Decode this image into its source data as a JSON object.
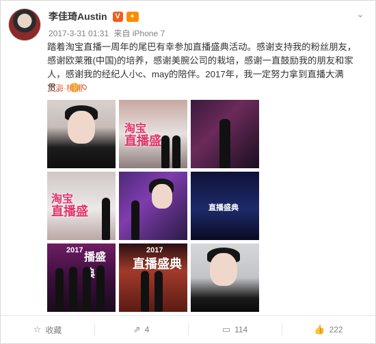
{
  "post": {
    "username": "李佳琦Austin",
    "verified_badge": "V",
    "member_badge": "会员",
    "timestamp": "2017-3-31 01:31",
    "source": "来自 iPhone 7",
    "text": "踏着淘宝直播一周年的尾巴有幸参加直播盛典活动。感谢支持我的粉丝朋友，感谢欧莱雅(中国)的培养，感谢美腕公司的栽培，感谢一直鼓励我的朋友和家人，感谢我的经纪人小c、may的陪伴。2017年，我一定努力拿到直播大满贯。",
    "location": "上海·桃浦"
  },
  "photos": {
    "p2_label_1": "淘宝",
    "p2_label_2": "直播盛",
    "p4_label_1": "淘宝",
    "p4_label_2": "直播盛",
    "p6_label_1": "直播盛典",
    "p7_label": "2017",
    "p7_label_2": "播盛典",
    "p8_label": "2017",
    "p8_label_2": "直播盛典"
  },
  "actions": {
    "favorite_label": "收藏",
    "repost_count": "4",
    "comment_count": "114",
    "like_count": "222"
  },
  "colors": {
    "accent": "#eb7350",
    "link": "#eb7350",
    "muted": "#808080",
    "verified": "#f25b1d"
  },
  "icons": [
    "chevron-down-icon",
    "smile-emoji-icon",
    "location-pin-icon",
    "star-icon",
    "repost-icon",
    "comment-icon",
    "like-icon"
  ]
}
